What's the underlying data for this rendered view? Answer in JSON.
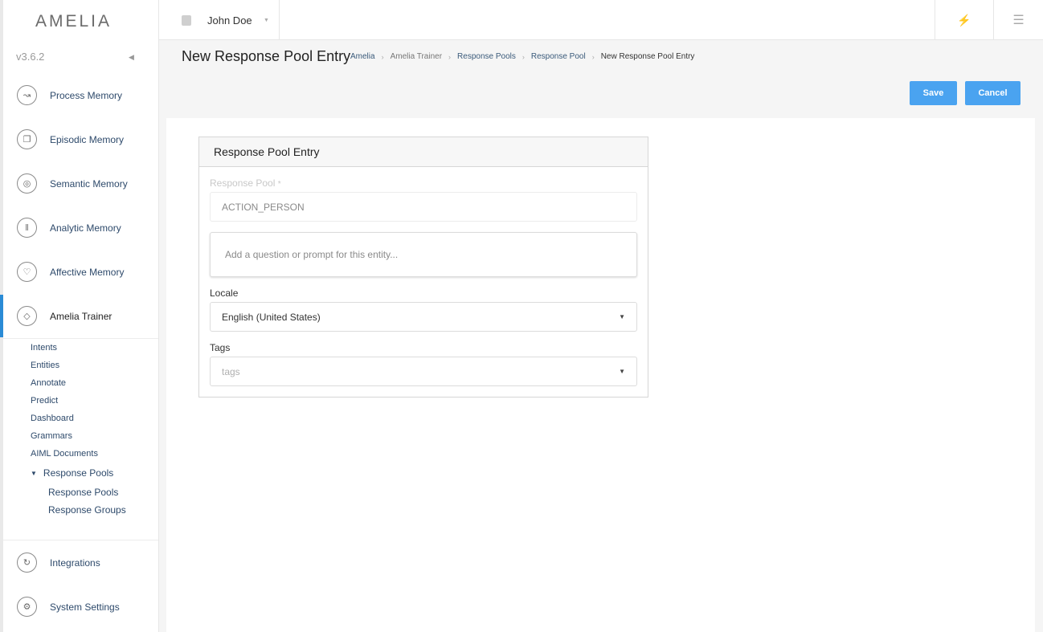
{
  "app": {
    "logo": "AMELIA",
    "version": "v3.6.2"
  },
  "sidebar": {
    "items": [
      {
        "label": "Process Memory",
        "icon": "process-memory-icon"
      },
      {
        "label": "Episodic Memory",
        "icon": "episodic-memory-icon"
      },
      {
        "label": "Semantic Memory",
        "icon": "semantic-memory-icon"
      },
      {
        "label": "Analytic Memory",
        "icon": "analytic-memory-icon"
      },
      {
        "label": "Affective Memory",
        "icon": "affective-memory-icon"
      },
      {
        "label": "Amelia Trainer",
        "icon": "amelia-trainer-icon"
      }
    ],
    "trainer_sub": [
      "Intents",
      "Entities",
      "Annotate",
      "Predict",
      "Dashboard",
      "Grammars",
      "AIML Documents"
    ],
    "response_pools_group": "Response Pools",
    "response_pools_sub": [
      "Response Pools",
      "Response Groups"
    ],
    "bottom_items": [
      {
        "label": "Integrations",
        "icon": "integrations-icon"
      },
      {
        "label": "System Settings",
        "icon": "settings-icon"
      }
    ]
  },
  "topbar": {
    "user_name": "John Doe"
  },
  "header": {
    "title": "New Response Pool Entry",
    "breadcrumb": [
      "Amelia",
      "Amelia Trainer",
      "Response Pools",
      "Response Pool",
      "New Response Pool Entry"
    ],
    "save_label": "Save",
    "cancel_label": "Cancel"
  },
  "form": {
    "card_title": "Response Pool Entry",
    "response_pool_label": "Response Pool",
    "response_pool_required": "*",
    "response_pool_value": "ACTION_PERSON",
    "prompt_placeholder": "Add a question or prompt for this entity...",
    "locale_label": "Locale",
    "locale_value": "English (United States)",
    "tags_label": "Tags",
    "tags_placeholder": "tags"
  },
  "colors": {
    "accent": "#4aa3f0",
    "active_bar": "#2a8bd6"
  }
}
